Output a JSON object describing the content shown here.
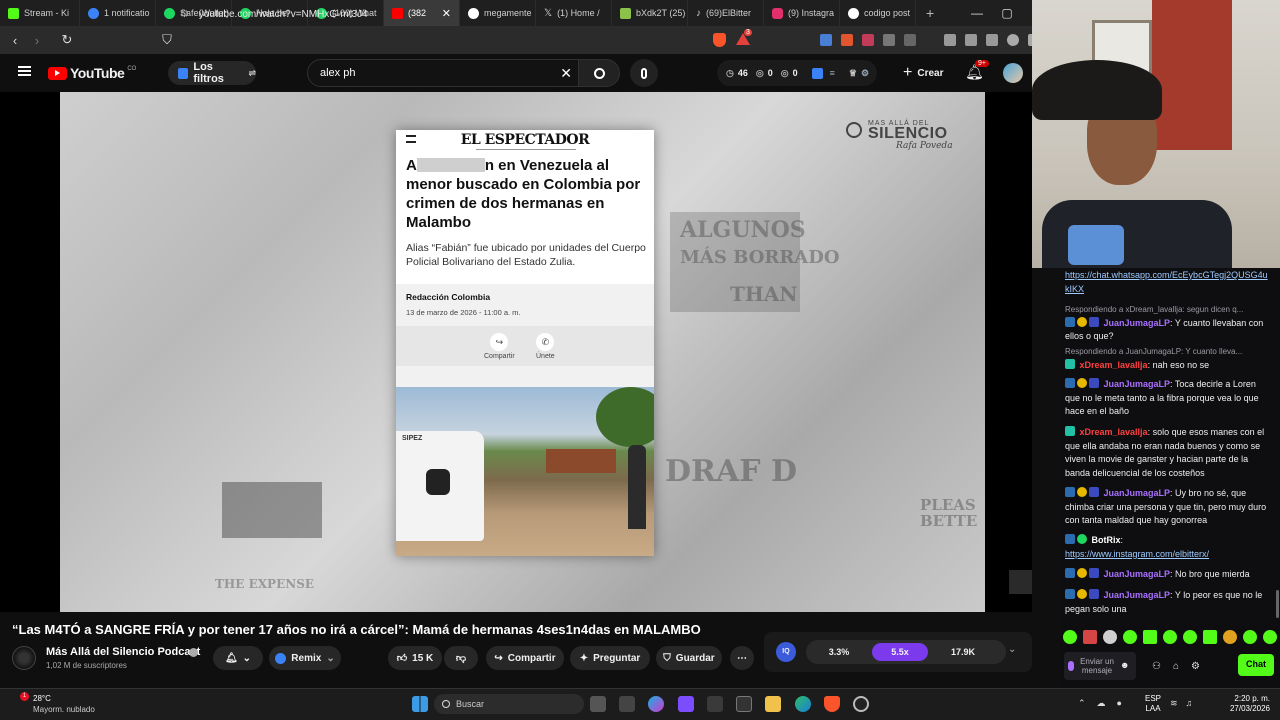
{
  "browser": {
    "tabs": [
      {
        "label": "Stream - Ki",
        "color": "#53fc18"
      },
      {
        "label": "1 notificatio",
        "color": "#3b82f6"
      },
      {
        "label": "Safe(Wallet)",
        "color": "#1ed760"
      },
      {
        "label": "Hola bei",
        "color": "#1ed760"
      },
      {
        "label": "(100) What",
        "color": "#25d366"
      },
      {
        "label": "(382",
        "color": "#ff0000"
      },
      {
        "label": "megamente",
        "color": "#ffffff"
      },
      {
        "label": "(1) Home /",
        "color": "#ffffff"
      },
      {
        "label": "bXdk2T (25)",
        "color": "#8bc34a"
      },
      {
        "label": "(69)ElBitter",
        "color": "#ffffff"
      },
      {
        "label": "(9) Instagra",
        "color": "#e1306c"
      },
      {
        "label": "codigo post",
        "color": "#ffffff"
      }
    ],
    "url": "youtube.com/watch?v=NMHxG-mt3J4",
    "brave_badge": "3"
  },
  "youtube": {
    "logo_text": "YouTube",
    "region": "CO",
    "filters_label": "Los filtros",
    "search_value": "alex ph",
    "stats": {
      "a": "46",
      "b": "0",
      "c": "0"
    },
    "create_label": "Crear",
    "notif_count": "9+"
  },
  "video": {
    "channel_watermark": "MAS ALLÁ DEL",
    "channel_watermark_big": "SILENCIO",
    "channel_watermark_sign": "Rafa Poveda",
    "bg_words": [
      "ALGUNOS",
      "MÁS BORRADO",
      "THAN",
      "DRAF D",
      "THE EXPENSE",
      "PLEAS BETTE"
    ],
    "article": {
      "masthead": "EL ESPECTADOR",
      "headline_part1": "A",
      "headline_part2": "n en Venezuela al menor buscado en Colombia por crimen de dos hermanas en Malambo",
      "summary": "Alias “Fabián” fue ubicado por unidades del Cuerpo Policial Bolivariano del Estado Zulia.",
      "byline": "Redacción Colombia",
      "date": "13 de marzo de 2026 - 11:00 a. m.",
      "share_label": "Compartir",
      "join_label": "Únete",
      "photo_text": "SIPEZ"
    }
  },
  "below": {
    "title": "“Las M4TÓ a SANGRE FRÍA y por tener 17 años no irá a cárcel”: Mamá de hermanas 4ses1n4das en MALAMBO",
    "channel": "Más Allá del Silencio Podcast",
    "subscribers": "1,02 M de suscriptores",
    "remix": "Remix",
    "likes": "15 K",
    "share": "Compartir",
    "ask": "Preguntar",
    "save": "Guardar",
    "stat1": "3.3%",
    "stat2": "5.5x",
    "stat3": "17.9K"
  },
  "chat": {
    "top_link": "https://chat.whatsapp.com/EcEybcGTegj2QUSG4ukIKX",
    "messages": [
      {
        "reply": "Respondiendo a xDream_lavallja: segun dicen q...",
        "user": "JuanJumagaLP",
        "color": "#a970ff",
        "text": ": Y cuanto llevaban con ellos o que?"
      },
      {
        "reply": "Respondiendo a JuanJumagaLP: Y cuanto lleva...",
        "user": "xDream_lavallja",
        "color": "#ff4040",
        "text": ": nah eso no se"
      },
      {
        "reply": "",
        "user": "JuanJumagaLP",
        "color": "#a970ff",
        "text": ": Toca decirle a Loren que no le meta tanto a la fibra porque vea lo que hace en el baño"
      },
      {
        "reply": "",
        "user": "xDream_lavallja",
        "color": "#ff4040",
        "text": ": solo que esos manes con el que ella andaba no eran nada buenos y como se viven la movie de ganster y hacian parte de la banda delicuencial de los costeños"
      },
      {
        "reply": "",
        "user": "JuanJumagaLP",
        "color": "#a970ff",
        "text": ": Uy bro no sé, que chimba criar una persona y que tin, pero muy duro con tanta maldad que hay gonorrea"
      },
      {
        "reply": "",
        "user": "BotRix",
        "color": "#ffffff",
        "text": ":"
      },
      {
        "reply": "",
        "user": "JuanJumagaLP",
        "color": "#a970ff",
        "text": ": No bro que mierda"
      },
      {
        "reply": "",
        "user": "JuanJumagaLP",
        "color": "#a970ff",
        "text": ": Y lo peor es que no le pegan solo una"
      }
    ],
    "botrix_link": "https://www.instagram.com/elbitterx/",
    "input_placeholder": "Enviar un mensaje",
    "chat_button": "Chat"
  },
  "taskbar": {
    "temp": "28°C",
    "weather": "Mayorm. nublado",
    "search_placeholder": "Buscar",
    "lang1": "ESP",
    "lang2": "LAA",
    "time": "2:20 p. m.",
    "date": "27/03/2026"
  },
  "colors": {
    "youtube_red": "#ff0000",
    "twitch_purple": "#a970ff",
    "kick_green": "#53fc18",
    "stat_active": "#7c3aed"
  }
}
